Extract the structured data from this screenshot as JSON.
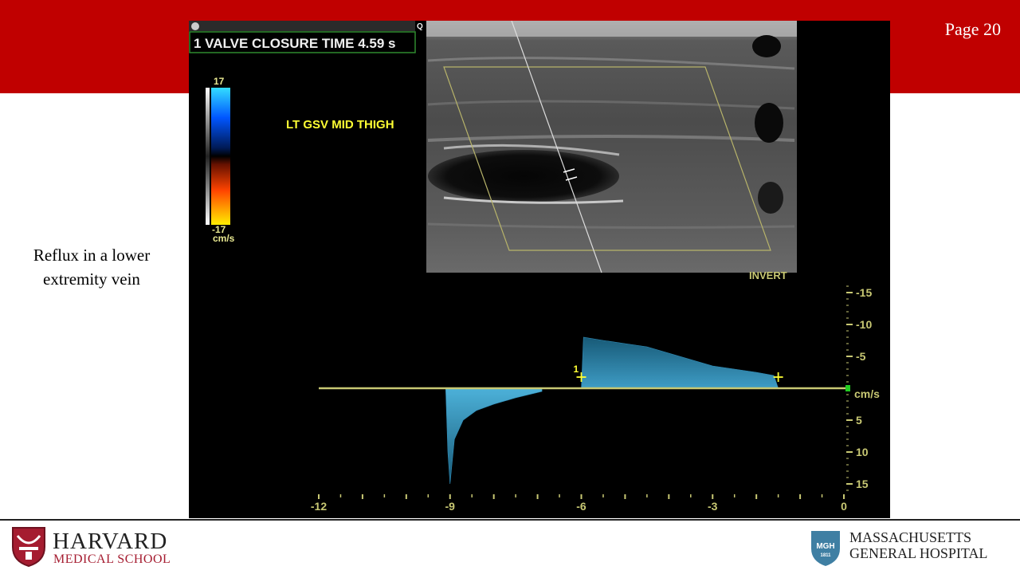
{
  "slide": {
    "page_label": "Page 20",
    "caption_line1": "Reflux in a lower",
    "caption_line2": "extremity vein"
  },
  "ultrasound": {
    "measurement_label": "1 VALVE CLOSURE TIME 4.59 s",
    "top_corner_label": "Q",
    "location_label": "LT GSV MID THIGH",
    "invert_label": "INVERT",
    "color_scale": {
      "max": "17",
      "min": "-17",
      "unit": "cm/s"
    },
    "marker_label": "1"
  },
  "chart_data": {
    "type": "area",
    "title": "",
    "xlabel": "",
    "ylabel": "cm/s",
    "x_ticks": [
      "-12",
      "-9",
      "-6",
      "-3",
      "0"
    ],
    "y_ticks": [
      "-15",
      "-10",
      "-5",
      "5",
      "10",
      "15"
    ],
    "xlim": [
      -12,
      0
    ],
    "ylim": [
      -17,
      17
    ],
    "y_inverted": true,
    "series": [
      {
        "x": [
          -9.1,
          -9.05,
          -9.0,
          -8.9,
          -8.7,
          -8.4,
          -8.0,
          -7.5,
          -6.9
        ],
        "y": [
          0,
          10,
          15,
          8,
          5,
          3.5,
          2.5,
          1.5,
          0.5
        ]
      },
      {
        "x": [
          -6.0,
          -5.95,
          -5.5,
          -5.0,
          -4.5,
          -4.0,
          -3.5,
          -3.0,
          -2.5,
          -2.0,
          -1.6,
          -1.5
        ],
        "y": [
          0,
          -8,
          -7.5,
          -7,
          -6.5,
          -5.5,
          -4.5,
          -3.5,
          -3,
          -2.5,
          -2,
          0
        ]
      }
    ],
    "cursor_x": [
      -6.0,
      -1.5
    ],
    "grid": false,
    "colors": {
      "flow": "#3aa6d9",
      "baseline": "#c8c873",
      "labels": "#c8c873",
      "overlay_text": "#ffff33"
    }
  },
  "logos": {
    "harvard_line1": "HARVARD",
    "harvard_line2": "MEDICAL SCHOOL",
    "mgh_line1": "MASSACHUSETTS",
    "mgh_line2": "GENERAL HOSPITAL",
    "mgh_badge": "MGH",
    "mgh_year": "1811"
  }
}
